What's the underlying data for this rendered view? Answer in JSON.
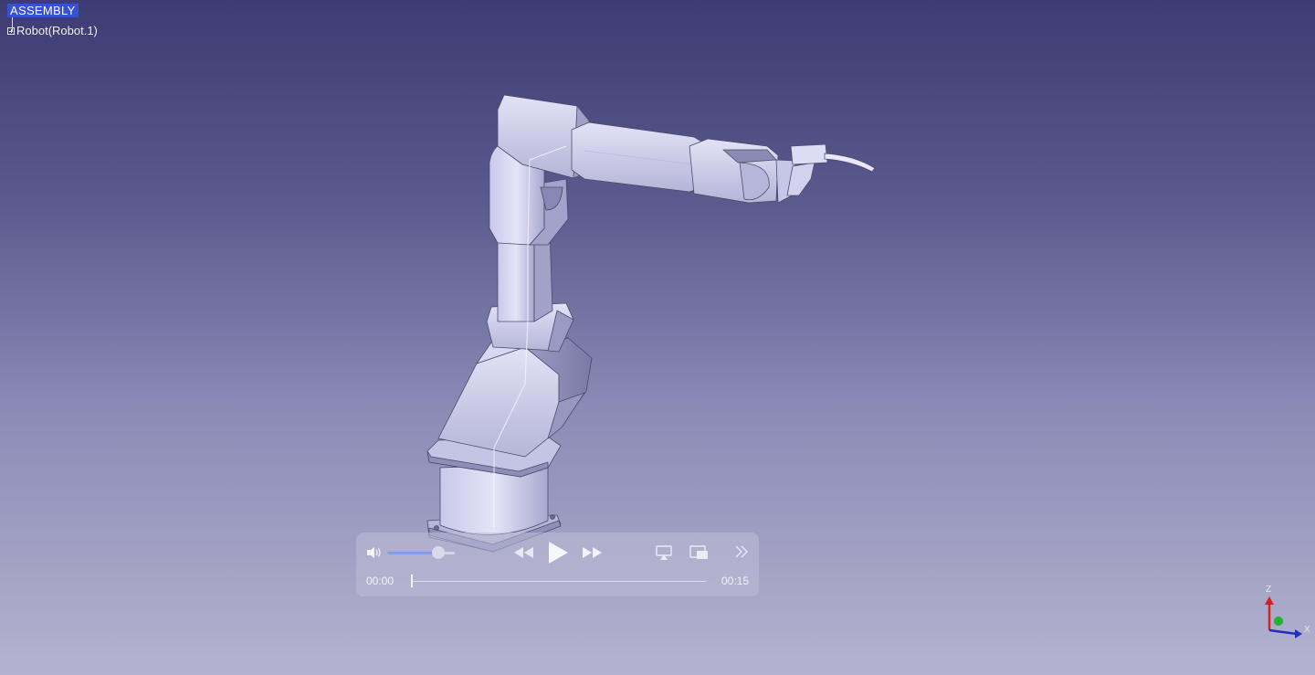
{
  "tree": {
    "root_label": "ASSEMBLY",
    "child_label": "Robot(Robot.1)"
  },
  "player": {
    "current_time": "00:00",
    "total_time": "00:15",
    "volume": 0.75,
    "progress": 0.0
  },
  "axis": {
    "z_label": "Z",
    "x_label": "X"
  },
  "colors": {
    "tree_highlight": "#3650d6",
    "robot_body": "#d6d6f0",
    "robot_shadow": "#a9a9cc",
    "axis_z": "#d62020",
    "axis_x": "#1f2fbf",
    "axis_y": "#22b030"
  },
  "icons": [
    "volume-icon",
    "rewind-icon",
    "play-icon",
    "fast-forward-icon",
    "airplay-icon",
    "picture-in-picture-icon",
    "chevron-double-right-icon",
    "expand-plus-icon"
  ]
}
